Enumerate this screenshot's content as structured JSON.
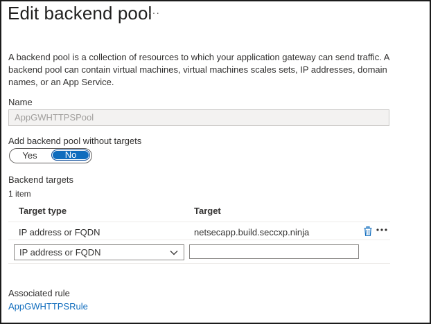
{
  "header": {
    "title": "Edit backend pool",
    "more": "···"
  },
  "description": "A backend pool is a collection of resources to which your application gateway can send traffic. A backend pool can contain virtual machines, virtual machines scales sets, IP addresses, domain names, or an App Service.",
  "name_field": {
    "label": "Name",
    "value": "AppGWHTTPSPool"
  },
  "without_targets": {
    "label": "Add backend pool without targets",
    "yes_label": "Yes",
    "no_label": "No",
    "selected": "No"
  },
  "backend_targets": {
    "heading": "Backend targets",
    "count": "1 item",
    "columns": [
      "Target type",
      "Target"
    ],
    "rows": [
      {
        "target_type": "IP address or FQDN",
        "target": "netsecapp.build.seccxp.ninja"
      }
    ],
    "new_row": {
      "target_type": "IP address or FQDN",
      "target": ""
    }
  },
  "associated_rule": {
    "label": "Associated rule",
    "link": "AppGWHTTPSRule"
  },
  "icons": {
    "delete": "trash-icon",
    "row_more": "more-icon",
    "dropdown": "chevron-down-icon"
  },
  "colors": {
    "accent": "#0f6cbd",
    "link": "#0f6cbd",
    "disabled_bg": "#f3f2f1"
  }
}
